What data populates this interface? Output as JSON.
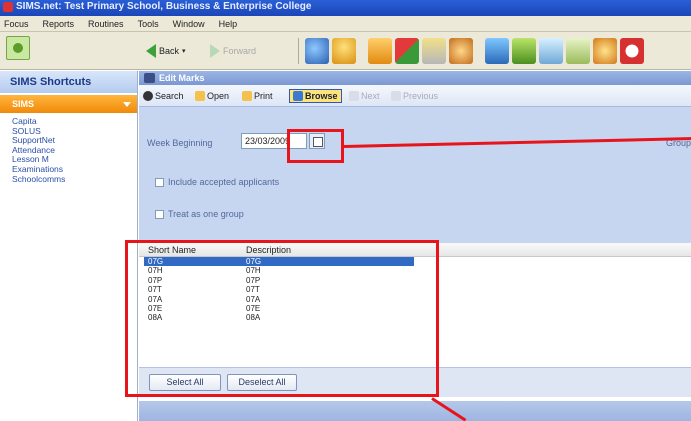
{
  "window": {
    "title": "SIMS.net: Test Primary School, Business & Enterprise College"
  },
  "menu": [
    "Focus",
    "Reports",
    "Routines",
    "Tools",
    "Window",
    "Help"
  ],
  "toolbar": {
    "back_label": "Back",
    "forward_label": "Forward"
  },
  "sidebar": {
    "title": "SIMS Shortcuts",
    "group": "SIMS",
    "items": [
      "Capita",
      "SOLUS",
      "SupportNet",
      "Attendance",
      "Lesson M",
      "Examinations",
      "Schoolcomms"
    ]
  },
  "panel": {
    "title": "Edit Marks",
    "commands": {
      "search": "Search",
      "open": "Open",
      "print": "Print",
      "browse": "Browse",
      "next": "Next",
      "previous": "Previous"
    },
    "week_beginning_label": "Week Beginning",
    "week_beginning_value": "23/03/2009",
    "group_label": "Group",
    "include_label": "Include accepted applicants",
    "treat_label": "Treat as one group"
  },
  "list": {
    "headers": [
      "Short Name",
      "Description"
    ],
    "rows": [
      [
        "07G",
        "07G"
      ],
      [
        "07H",
        "07H"
      ],
      [
        "07P",
        "07P"
      ],
      [
        "07T",
        "07T"
      ],
      [
        "07A",
        "07A"
      ],
      [
        "07E",
        "07E"
      ],
      [
        "08A",
        "08A"
      ]
    ],
    "selected_index": 0,
    "select_all": "Select All",
    "deselect_all": "Deselect All"
  },
  "colors": {
    "highlight": "#e8141c",
    "selection": "#316ac5",
    "sidebar_group": "#f08a0a"
  }
}
